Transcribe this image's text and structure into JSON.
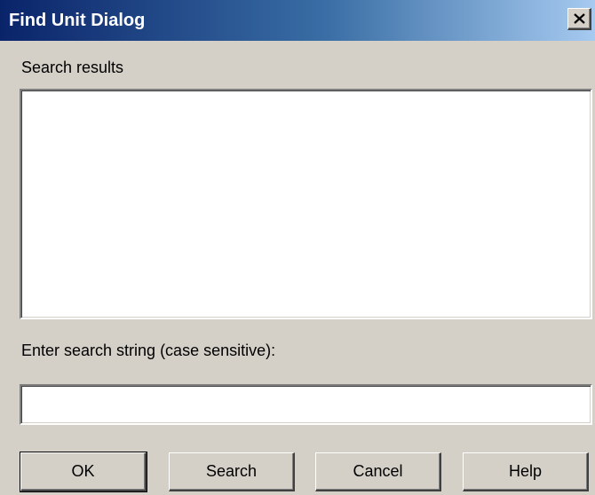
{
  "window": {
    "title": "Find Unit Dialog",
    "close_icon": "close-x-icon"
  },
  "results": {
    "label": "Search results",
    "items": []
  },
  "search": {
    "label": "Enter search string (case sensitive):",
    "value": ""
  },
  "buttons": {
    "ok": "OK",
    "search": "Search",
    "cancel": "Cancel",
    "help": "Help"
  },
  "colors": {
    "face": "#d4d0c8",
    "titlebar_start": "#0a246a",
    "titlebar_end": "#a6caf0"
  }
}
